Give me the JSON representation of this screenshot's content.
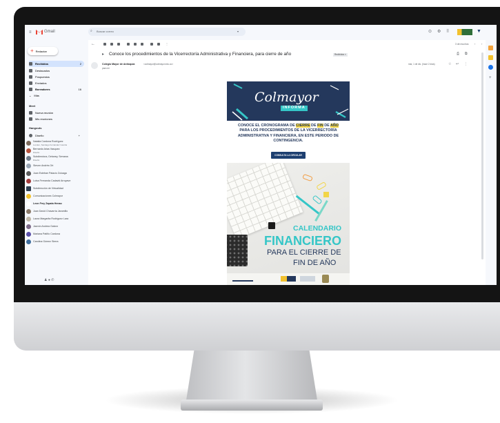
{
  "gmail": {
    "app_name": "Gmail",
    "search_placeholder": "Buscar correo",
    "compose_label": "Redactar",
    "nav": [
      {
        "label": "Recibidos",
        "count": "2"
      },
      {
        "label": "Destacados",
        "count": ""
      },
      {
        "label": "Pospuestos",
        "count": ""
      },
      {
        "label": "Enviados",
        "count": ""
      },
      {
        "label": "Borradores",
        "count": "16"
      },
      {
        "label": "Más",
        "count": ""
      }
    ],
    "meet": {
      "heading": "Meet",
      "items": [
        "Nueva reunión",
        "Mis reuniones"
      ]
    },
    "hangouts": {
      "heading": "Hangouts",
      "user": "Diseño",
      "contacts": [
        {
          "name": "Natalia Cardona Rodríguez",
          "status": "Lunden, Santiago Fernández Gaviria"
        },
        {
          "name": "Bernardo Arias Vasquez",
          "status": "Diseño"
        },
        {
          "name": "Subdirectora, Delaney, Semana",
          "status": "Diseño"
        },
        {
          "name": "Steven Andrés Ort",
          "status": ""
        },
        {
          "name": "Juan Esteban Palacio Zuluaga",
          "status": ""
        },
        {
          "name": "Luisa Fernanda Cadavid Arroyave",
          "status": ""
        },
        {
          "name": "Subdirección de Virtualidad",
          "status": ""
        },
        {
          "name": "Comunicaciones Colmayor",
          "status": ""
        },
        {
          "name": "Leon Frey Zapata Henao",
          "status": ""
        },
        {
          "name": "Juan David Chavarría Jaramillo",
          "status": ""
        },
        {
          "name": "Laura Margarita Rodríguez Lara",
          "status": ""
        },
        {
          "name": "Jasmín Andrea Galvez",
          "status": ""
        },
        {
          "name": "Mariana Patiño Cardona",
          "status": ""
        },
        {
          "name": "Carolina Gómez Sierra",
          "status": ""
        }
      ]
    },
    "toolbar": {
      "pager": "3 de muchos"
    },
    "email": {
      "subject": "Conoce los procedimientos de la Vicerrectoría Administrativa y Financiera, para cierre de año",
      "label_tag": "Recibidos ×",
      "sender": "Colegio Mayor de Antioquia",
      "sender_email": "<colmayor@colmayor.edu.co>",
      "to": "para mí",
      "date": "mar, 1 de dic. (hace 2 días)"
    }
  },
  "poster": {
    "logo_main": "Colmayor",
    "logo_sub": "INFORMA",
    "headline_parts": [
      "CONOCE EL CRONOGRAMA DE ",
      "CIERRE",
      " DE ",
      "FIN",
      " DE ",
      "AÑO",
      " PARA LOS PROCEDIMIENTOS DE LA VICERRECTORÍA ADMINISTRATIVA Y FINANCIERA, EN ESTE PERIODO DE CONTINGENCIA."
    ],
    "button_label": "CONSULTA LA CIRCULAR",
    "cal_line1": "CALENDARIO",
    "cal_line2": "FINANCIERO",
    "cal_line3": "PARA EL CIERRE DE",
    "cal_line4": "FIN DE AÑO"
  },
  "colors": {
    "banner": "#24385c",
    "accent_teal": "#35c6c7",
    "highlight": "#f2d548",
    "gmail_red": "#ea4335"
  }
}
